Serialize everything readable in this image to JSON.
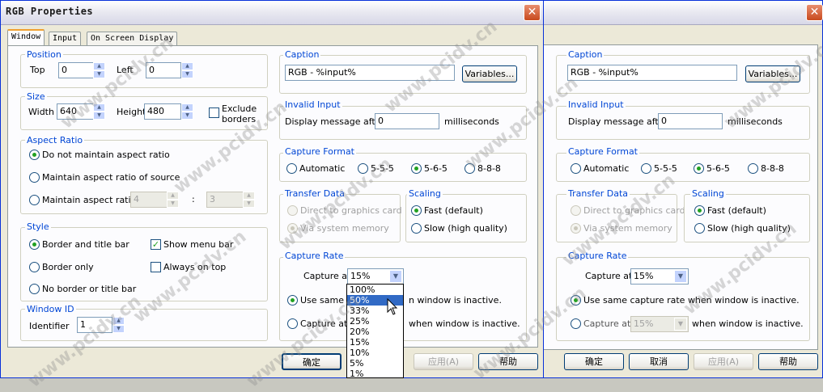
{
  "window": {
    "title": "RGB Properties",
    "close_icon": "close-icon"
  },
  "tabs": [
    {
      "label": "Window",
      "active": true
    },
    {
      "label": "Input",
      "active": false
    },
    {
      "label": "On Screen Display",
      "active": false
    }
  ],
  "position": {
    "legend": "Position",
    "top_label": "Top",
    "top_value": "0",
    "left_label": "Left",
    "left_value": "0"
  },
  "size": {
    "legend": "Size",
    "width_label": "Width",
    "width_value": "640",
    "height_label": "Height",
    "height_value": "480",
    "exclude_borders_line1": "Exclude",
    "exclude_borders_line2": "borders",
    "exclude_borders_checked": false
  },
  "aspect_ratio": {
    "legend": "Aspect Ratio",
    "options": [
      {
        "label": "Do not maintain aspect ratio",
        "selected": true
      },
      {
        "label": "Maintain aspect ratio of source",
        "selected": false
      },
      {
        "label": "Maintain aspect ratio",
        "selected": false
      }
    ],
    "ratio_a": "4",
    "ratio_sep": ":",
    "ratio_b": "3"
  },
  "style": {
    "legend": "Style",
    "options": [
      {
        "label": "Border and title bar",
        "selected": true
      },
      {
        "label": "Border only",
        "selected": false
      },
      {
        "label": "No border or title bar",
        "selected": false
      }
    ],
    "show_menu_bar": {
      "label": "Show menu bar",
      "checked": true
    },
    "always_on_top": {
      "label": "Always on top",
      "checked": false
    }
  },
  "window_id": {
    "legend": "Window ID",
    "identifier_label": "Identifier",
    "identifier_value": "1"
  },
  "caption": {
    "legend": "Caption",
    "value": "RGB - %input%",
    "variables_button": "Variables..."
  },
  "invalid_input": {
    "legend": "Invalid Input",
    "label": "Display message after",
    "value": "0",
    "unit": "milliseconds"
  },
  "capture_format": {
    "legend": "Capture Format",
    "options": [
      {
        "label": "Automatic",
        "selected": false
      },
      {
        "label": "5-5-5",
        "selected": false
      },
      {
        "label": "5-6-5",
        "selected": true
      },
      {
        "label": "8-8-8",
        "selected": false
      }
    ]
  },
  "transfer_data": {
    "legend": "Transfer Data",
    "options": [
      {
        "label": "Direct to graphics card",
        "selected": false
      },
      {
        "label": "Via system memory",
        "selected": true
      }
    ]
  },
  "scaling": {
    "legend": "Scaling",
    "options": [
      {
        "label": "Fast (default)",
        "selected": true
      },
      {
        "label": "Slow (high quality)",
        "selected": false
      }
    ]
  },
  "capture_rate": {
    "legend": "Capture Rate",
    "capture_at_label": "Capture at",
    "capture_at_value": "15%",
    "use_same_label": "Use same capture rate when window is inactive.",
    "use_same_partial": "Use same c",
    "use_same_tail": "n window is inactive.",
    "capture_at2_label": "Capture at",
    "capture_at2_value": "15%",
    "inactive_label": "when window is inactive.",
    "dropdown_options": [
      "100%",
      "50%",
      "33%",
      "25%",
      "20%",
      "15%",
      "10%",
      "5%",
      "1%"
    ],
    "dropdown_highlighted": "50%"
  },
  "buttons": {
    "ok": "确定",
    "cancel": "取消",
    "apply": "应用(A)",
    "help": "帮助"
  },
  "watermark": "www.pcidv.cn",
  "colors": {
    "legend_blue": "#0046d5",
    "selection_blue": "#316ac5",
    "title_border": "#0831d9",
    "radio_green": "#21a121"
  }
}
